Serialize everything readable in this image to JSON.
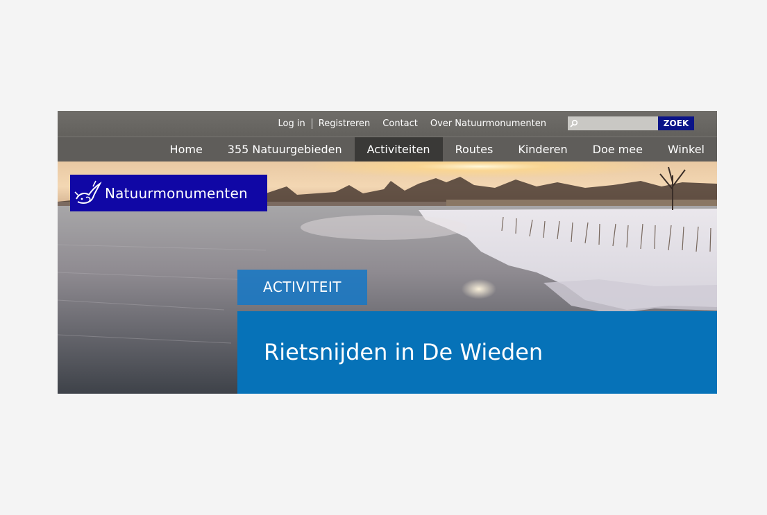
{
  "utility_nav": {
    "links": [
      "Log in",
      "Registreren",
      "Contact",
      "Over Natuurmonumenten"
    ]
  },
  "search": {
    "placeholder": "",
    "button_label": "ZOEK"
  },
  "main_nav": {
    "items": [
      "Home",
      "355 Natuurgebieden",
      "Activiteiten",
      "Routes",
      "Kinderen",
      "Doe mee",
      "Winkel"
    ],
    "active": "Activiteiten"
  },
  "logo": {
    "text": "Natuurmonumenten"
  },
  "hero": {
    "category": "ACTIVITEIT",
    "title": "Rietsnijden in De Wieden",
    "image": "winter-sunset-frozen-lake-reeds"
  },
  "colors": {
    "utility_bar": "#68665f",
    "nav_bar": "#5f5d5a",
    "nav_active": "#3a3937",
    "search_button": "#0a1388",
    "logo_bg": "#1007a5",
    "category_bg": "#1878c4",
    "title_panel": "#0672b8"
  }
}
